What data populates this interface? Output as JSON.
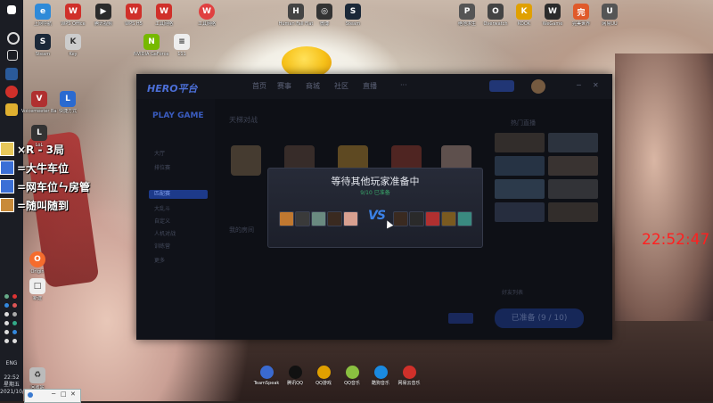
{
  "clock": "22:52:47",
  "taskbar": {
    "time": "22:52",
    "day": "星期五",
    "date": "2021/10/1",
    "lang": "ENG"
  },
  "overlay": [
    {
      "text": "×R - 3局",
      "color": "#e8c85a"
    },
    {
      "text": "=大牛车位",
      "color": "#3b6fd6"
    },
    {
      "text": "=网车位ㄣ房管",
      "color": "#3b6fd6"
    },
    {
      "text": "=随叫随到",
      "color": "#c88a3a"
    }
  ],
  "desktop_icons": [
    {
      "label": "上网导航",
      "color": "#2f8ad8",
      "glyph": "e"
    },
    {
      "label": "WPS Office",
      "color": "#d0302a",
      "glyph": "W"
    },
    {
      "label": "腾讯视频",
      "color": "#ff6a00",
      "glyph": "▶"
    },
    {
      "label": "WPS H5",
      "color": "#d0302a",
      "glyph": "W"
    },
    {
      "label": "工具网络",
      "color": "#d0302a",
      "glyph": "W"
    },
    {
      "label": "工具网络",
      "color": "#d0302a",
      "glyph": "W"
    },
    {
      "label": "Human Fall Flat",
      "color": "#444",
      "glyph": "H"
    },
    {
      "label": "微博",
      "color": "#333",
      "glyph": "◎"
    },
    {
      "label": "Steam",
      "color": "#1b2838",
      "glyph": "S"
    },
    {
      "label": "绝地求生",
      "color": "#555",
      "glyph": "P"
    },
    {
      "label": "Overwatch",
      "color": "#444",
      "glyph": "O"
    },
    {
      "label": "KOOK",
      "color": "#e0a000",
      "glyph": "K"
    },
    {
      "label": "WeGame",
      "color": "#2b2b2b",
      "glyph": "W"
    },
    {
      "label": "完美世界",
      "color": "#e05a2a",
      "glyph": "完"
    },
    {
      "label": "网易UU",
      "color": "#555",
      "glyph": "U"
    }
  ],
  "desktop_icons_row2": [
    {
      "label": "Steam",
      "color": "#1b2838",
      "glyph": "S"
    },
    {
      "label": "Key",
      "color": "#ccc",
      "glyph": "K"
    },
    {
      "label": "NVIDIA GeForce Experience",
      "color": "#76b900",
      "glyph": "N"
    },
    {
      "label": "111",
      "color": "#eee",
      "glyph": "≡"
    }
  ],
  "left_icons": [
    {
      "label": "Voicemeeter Banana",
      "color": "#b03030",
      "glyph": "V"
    },
    {
      "label": "快捷方式",
      "color": "#2a6ad0",
      "glyph": "L"
    },
    {
      "label": "LoL",
      "color": "#333",
      "glyph": "L"
    },
    {
      "label": "Origin",
      "color": "#f56c2d",
      "glyph": "O"
    },
    {
      "label": "新建",
      "color": "#eee",
      "glyph": "□"
    },
    {
      "label": "回收站",
      "color": "#bbb",
      "glyph": "♻"
    }
  ],
  "app": {
    "logo": "HERO平台",
    "nav": [
      "首页",
      "赛事",
      "商城",
      "社区",
      "直播",
      "···"
    ],
    "sidebar_title": "PLAY GAME",
    "sidebar_items": [
      "大厅",
      "排位赛",
      "匹配赛",
      "大乱斗",
      "自定义",
      "人机对战",
      "训练营",
      "更多"
    ],
    "section_title": "天梯对战",
    "mode_title": "我的房间",
    "rooms_title": "热门直播",
    "list_title": "好友列表",
    "ready_button": "已准备 (9 / 10)"
  },
  "modal": {
    "title": "等待其他玩家准备中",
    "ready_count": "9/10",
    "ready_text": "已准备",
    "vs": "VS",
    "team_left": [
      "#c07830",
      "#4a4a4a",
      "#6a8a80",
      "#3a2a20",
      "#d8a090"
    ],
    "team_right": [
      "#3a2a20",
      "#2a2a2a",
      "#b03030",
      "#7a5a20",
      "#3a8a80"
    ]
  },
  "dock": [
    {
      "label": "TeamSpeak",
      "color": "#3a6ad0"
    },
    {
      "label": "腾讯QQ",
      "color": "#111"
    },
    {
      "label": "QQ游戏",
      "color": "#e0a000"
    },
    {
      "label": "QQ音乐",
      "color": "#8ac040"
    },
    {
      "label": "酷狗音乐",
      "color": "#1a8ae0"
    },
    {
      "label": "网易云音乐",
      "color": "#d0302a"
    }
  ]
}
